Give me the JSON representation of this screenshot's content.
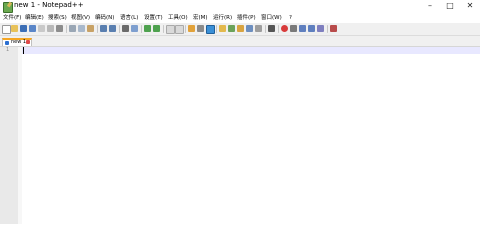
{
  "window": {
    "title": "new 1 - Notepad++",
    "minimize_glyph": "–",
    "maximize_glyph": "□",
    "close_glyph": "✕"
  },
  "menu": [
    {
      "label": "文件(F)"
    },
    {
      "label": "编辑(E)"
    },
    {
      "label": "搜索(S)"
    },
    {
      "label": "视图(V)"
    },
    {
      "label": "编码(N)"
    },
    {
      "label": "语言(L)"
    },
    {
      "label": "设置(T)"
    },
    {
      "label": "工具(O)"
    },
    {
      "label": "宏(M)"
    },
    {
      "label": "运行(R)"
    },
    {
      "label": "插件(P)"
    },
    {
      "label": "窗口(W)"
    },
    {
      "label": "?"
    }
  ],
  "toolbar": {
    "icons": [
      "new-file-icon",
      "open-file-icon",
      "save-icon",
      "save-all-icon",
      "close-icon",
      "close-all-icon",
      "print-icon",
      "cut-icon",
      "copy-icon",
      "paste-icon",
      "undo-icon",
      "redo-icon",
      "find-icon",
      "replace-icon",
      "zoom-in-icon",
      "zoom-out-icon",
      "sync-vertical-icon",
      "sync-horizontal-icon",
      "word-wrap-icon",
      "show-all-chars-icon",
      "indent-guide-icon",
      "udl-icon",
      "doc-map-icon",
      "function-list-icon",
      "folder-workspace-icon",
      "doc-list-icon",
      "monitoring-icon",
      "record-macro-icon",
      "stop-record-icon",
      "play-macro-icon",
      "run-macro-multiple-icon",
      "save-macro-icon",
      "spell-check-icon"
    ]
  },
  "tabs": [
    {
      "label": "new 1",
      "active": true
    }
  ],
  "editor": {
    "line_numbers": [
      "1"
    ],
    "current_line_color": "#e8e8ff"
  },
  "colors": {
    "tab_accent": "#f5a623",
    "toolbar_bg": "#f0f0f0",
    "gutter_bg": "#e9e9e9"
  }
}
